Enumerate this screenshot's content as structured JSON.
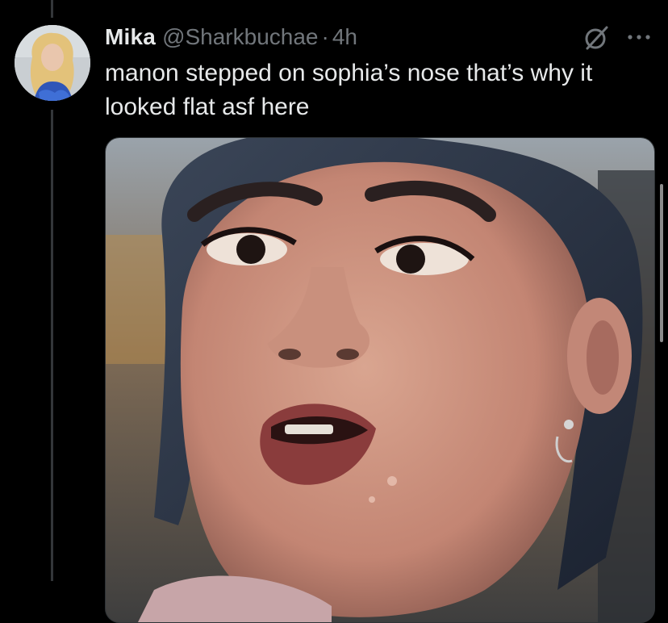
{
  "tweet": {
    "display_name": "Mika",
    "handle": "@Sharkbuchae",
    "separator": "·",
    "time": "4h",
    "text": "manon stepped on sophia’s nose that’s why it\nlooked flat asf here"
  },
  "icons": {
    "avatar": "avatar-photo",
    "grok": "grok-icon",
    "more": "more-options-icon"
  },
  "colors": {
    "background": "#000000",
    "primary_text": "#e7e9ea",
    "secondary_text": "#71767b",
    "thread_line": "#333639",
    "border": "#2f3336"
  }
}
